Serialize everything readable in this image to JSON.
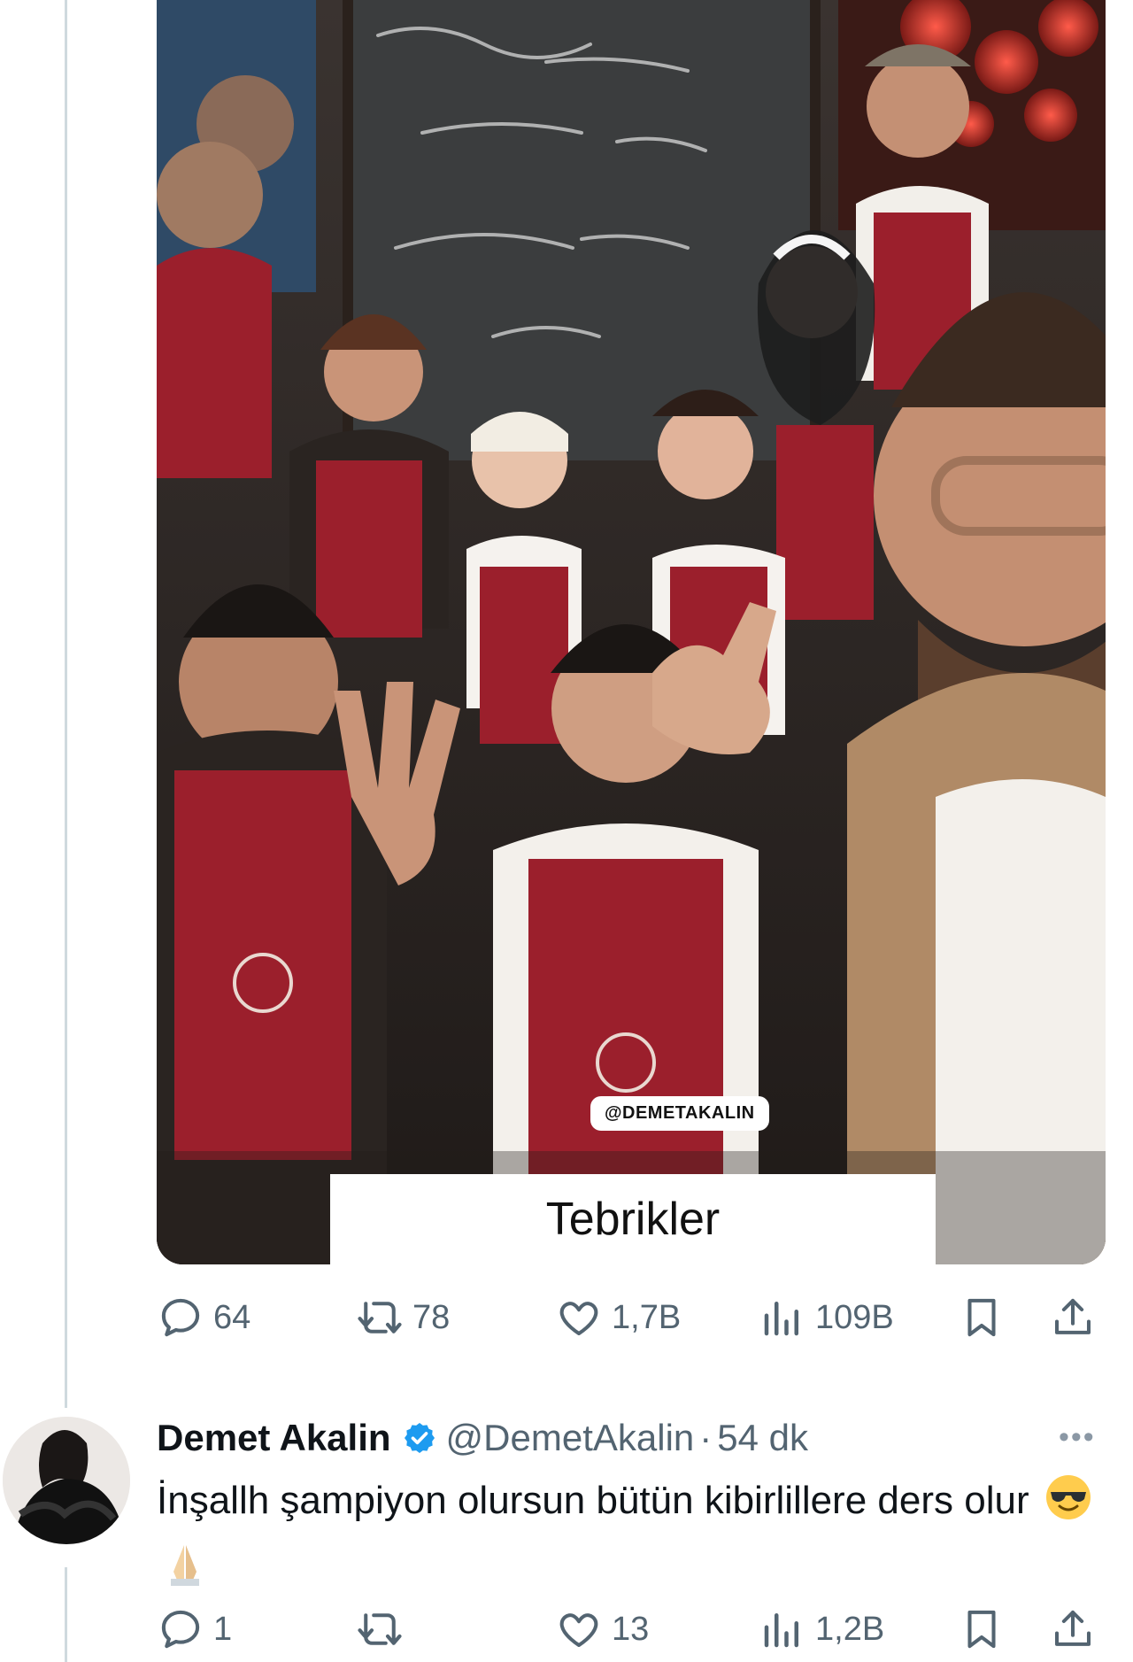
{
  "post": {
    "media": {
      "tag_label": "@DEMETAKALIN",
      "caption": "Tebrikler"
    },
    "actions": {
      "replies": "64",
      "reposts": "78",
      "likes": "1,7B",
      "views": "109B"
    }
  },
  "reply": {
    "author_name": "Demet Akalin",
    "handle": "@DemetAkalin",
    "separator": "·",
    "time": "54 dk",
    "text": "İnşallh şampiyon olursun bütün kibirlillere ders olur",
    "emojis": [
      "smiling-face-with-sunglasses",
      "folded-hands"
    ],
    "actions": {
      "replies": "1",
      "reposts": "",
      "likes": "13",
      "views": "1,2B"
    }
  },
  "colors": {
    "icon_gray": "#536471",
    "text": "#0f1419",
    "verified_blue": "#1d9bf0",
    "apron_red": "#9b1f2c"
  }
}
